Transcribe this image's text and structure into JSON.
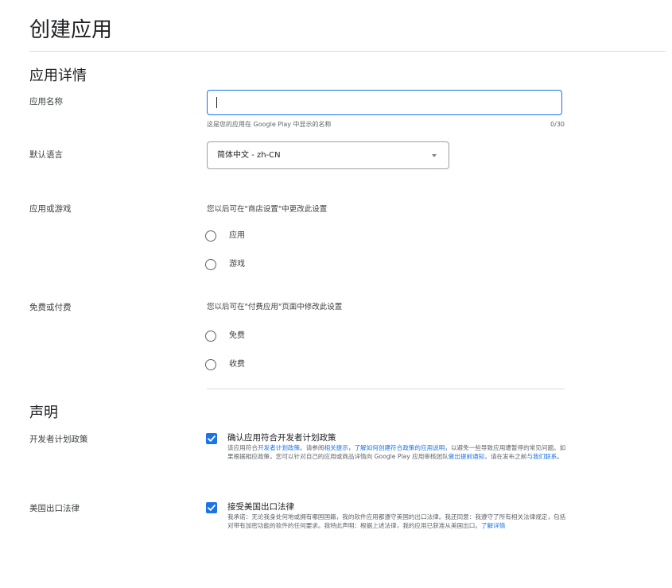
{
  "page": {
    "title": "创建应用"
  },
  "app_details": {
    "section_title": "应用详情",
    "app_name": {
      "label": "应用名称",
      "value": "",
      "hint": "这是您的应用在 Google Play 中显示的名称",
      "counter": "0/30"
    },
    "default_language": {
      "label": "默认语言",
      "selected": "简体中文 - zh-CN"
    },
    "app_or_game": {
      "label": "应用或游戏",
      "description": "您以后可在\"商店设置\"中更改此设置",
      "options": [
        "应用",
        "游戏"
      ]
    },
    "free_or_paid": {
      "label": "免费或付费",
      "description": "您以后可在\"付费应用\"页面中修改此设置",
      "options": [
        "免费",
        "收费"
      ]
    }
  },
  "declarations": {
    "section_title": "声明",
    "developer_policy": {
      "label": "开发者计划政策",
      "checked": true,
      "title": "确认应用符合开发者计划政策",
      "body": {
        "t1": "该应用符合",
        "l1": "开发者计划政策",
        "t2": "。请参阅",
        "l2": "相关提示",
        "t3": "，",
        "l3": "了解如何创建符合政策的应用说明",
        "t4": "，以避免一些导致应用遭暂停的常见问题。如果根据相应政策，您可以针对自己的应用或商品详情向 Google Play 应用审核团队",
        "l4": "做出提前通知",
        "t5": "，请在发布之前",
        "l5": "与我们联系",
        "t6": "。"
      }
    },
    "us_export": {
      "label": "美国出口法律",
      "checked": true,
      "title": "接受美国出口法律",
      "body": {
        "t1": "我承诺：无论我身处何地或拥有哪国国籍，我的软件应用都遵守美国的出口法律。我还同意：我遵守了所有相关法律规定，包括对带有加密功能的软件的任何要求。我特此声明：根据上述法律，我的应用已获准从美国出口。",
        "l1": "了解详情"
      }
    }
  },
  "colors": {
    "accent": "#1a73e8",
    "text": "#202124",
    "secondary": "#5f6368",
    "divider": "#dadce0"
  },
  "icons": {
    "checkbox": "check-icon",
    "dropdown": "chevron-down-icon"
  }
}
